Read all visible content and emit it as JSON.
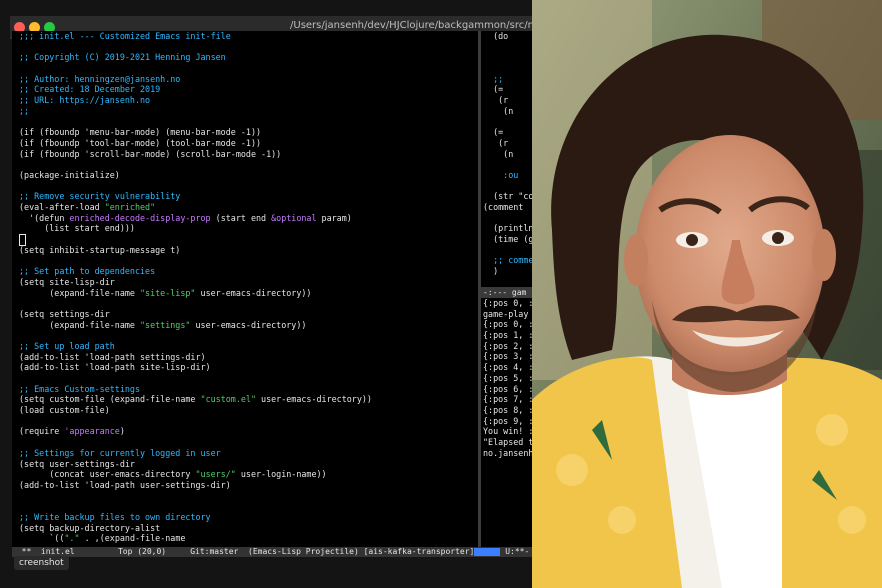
{
  "window": {
    "path": "/Users/jansenh/dev/HJClojure/backgammon/src/no/jansenh/backg"
  },
  "editor": {
    "lines": [
      {
        "t": ";;; init.el --- Customized Emacs init-file",
        "k": "comment"
      },
      {
        "t": "",
        "k": "plain"
      },
      {
        "t": ";; Copyright (C) 2019-2021 Henning Jansen",
        "k": "comment"
      },
      {
        "t": "",
        "k": "plain"
      },
      {
        "t": ";; Author: henningzen@jansenh.no",
        "k": "comment"
      },
      {
        "t": ";; Created: 18 December 2019",
        "k": "comment"
      },
      {
        "t": ";; URL: https://jansenh.no",
        "k": "comment"
      },
      {
        "t": ";;",
        "k": "comment"
      },
      {
        "t": "",
        "k": "plain"
      },
      {
        "t": "(if (fboundp 'menu-bar-mode) (menu-bar-mode -1))",
        "k": "plain"
      },
      {
        "t": "(if (fboundp 'tool-bar-mode) (tool-bar-mode -1))",
        "k": "plain"
      },
      {
        "t": "(if (fboundp 'scroll-bar-mode) (scroll-bar-mode -1))",
        "k": "plain"
      },
      {
        "t": "",
        "k": "plain"
      },
      {
        "t": "(package-initialize)",
        "k": "plain"
      },
      {
        "t": "",
        "k": "plain"
      },
      {
        "t": ";; Remove security vulnerability",
        "k": "comment"
      },
      {
        "t": "(eval-after-load \"enriched\"",
        "k": "plain"
      },
      {
        "t": "  '(defun enriched-decode-display-prop (start end &optional param)",
        "k": "plain"
      },
      {
        "t": "     (list start end)))",
        "k": "plain"
      },
      {
        "t": "",
        "k": "cursor"
      },
      {
        "t": "(setq inhibit-startup-message t)",
        "k": "plain"
      },
      {
        "t": "",
        "k": "plain"
      },
      {
        "t": ";; Set path to dependencies",
        "k": "comment"
      },
      {
        "t": "(setq site-lisp-dir",
        "k": "plain"
      },
      {
        "t": "      (expand-file-name \"site-lisp\" user-emacs-directory))",
        "k": "plain"
      },
      {
        "t": "",
        "k": "plain"
      },
      {
        "t": "(setq settings-dir",
        "k": "plain"
      },
      {
        "t": "      (expand-file-name \"settings\" user-emacs-directory))",
        "k": "plain"
      },
      {
        "t": "",
        "k": "plain"
      },
      {
        "t": ";; Set up load path",
        "k": "comment"
      },
      {
        "t": "(add-to-list 'load-path settings-dir)",
        "k": "plain"
      },
      {
        "t": "(add-to-list 'load-path site-lisp-dir)",
        "k": "plain"
      },
      {
        "t": "",
        "k": "plain"
      },
      {
        "t": ";; Emacs Custom-settings",
        "k": "comment"
      },
      {
        "t": "(setq custom-file (expand-file-name \"custom.el\" user-emacs-directory))",
        "k": "plain"
      },
      {
        "t": "(load custom-file)",
        "k": "plain"
      },
      {
        "t": "",
        "k": "plain"
      },
      {
        "t": "(require 'appearance)",
        "k": "plain"
      },
      {
        "t": "",
        "k": "plain"
      },
      {
        "t": ";; Settings for currently logged in user",
        "k": "comment"
      },
      {
        "t": "(setq user-settings-dir",
        "k": "plain"
      },
      {
        "t": "      (concat user-emacs-directory \"users/\" user-login-name))",
        "k": "plain"
      },
      {
        "t": "(add-to-list 'load-path user-settings-dir)",
        "k": "plain"
      },
      {
        "t": "",
        "k": "plain"
      },
      {
        "t": "",
        "k": "plain"
      },
      {
        "t": ";; Write backup files to own directory",
        "k": "comment"
      },
      {
        "t": "(setq backup-directory-alist",
        "k": "plain"
      },
      {
        "t": "      `((\".\" . ,(expand-file-name",
        "k": "plain"
      }
    ]
  },
  "right_pane": {
    "top_lines": [
      "  (do",
      "",
      "",
      "",
      "  ;;",
      "  (=",
      "   (r",
      "    (n",
      "",
      "  (=",
      "   (r",
      "    (n",
      "",
      "    :ou",
      "",
      "  (str \"con",
      "(comment",
      "",
      "  (println",
      "  (time (ga",
      "",
      "  ;; comme",
      "  )"
    ],
    "mode_text": "-:---  gam",
    "bottom_lines": [
      "{:pos 0, :",
      "game-play",
      "{:pos 0, :",
      "{:pos 1, :",
      "{:pos 2, :",
      "{:pos 3, :",
      "{:pos 4, :",
      "{:pos 5, :",
      "{:pos 6, :",
      "{:pos 7, :",
      "{:pos 8, :",
      "{:pos 9, :",
      "You win! :",
      "\"Elapsed t",
      "no.jansenh"
    ]
  },
  "modeline": {
    "text": "  **  init.el         Top (20,0)     Git:master  (Emacs-Lisp Projectile) [ais-kafka-transporter]",
    "right_text": " U:**-  *c"
  },
  "tooltip": {
    "text": "creenshot"
  },
  "colors": {
    "comment": "#2fb8ff",
    "string": "#4fd16a",
    "keyword": "#c67bff",
    "modeline_accent": "#3b7fff"
  }
}
